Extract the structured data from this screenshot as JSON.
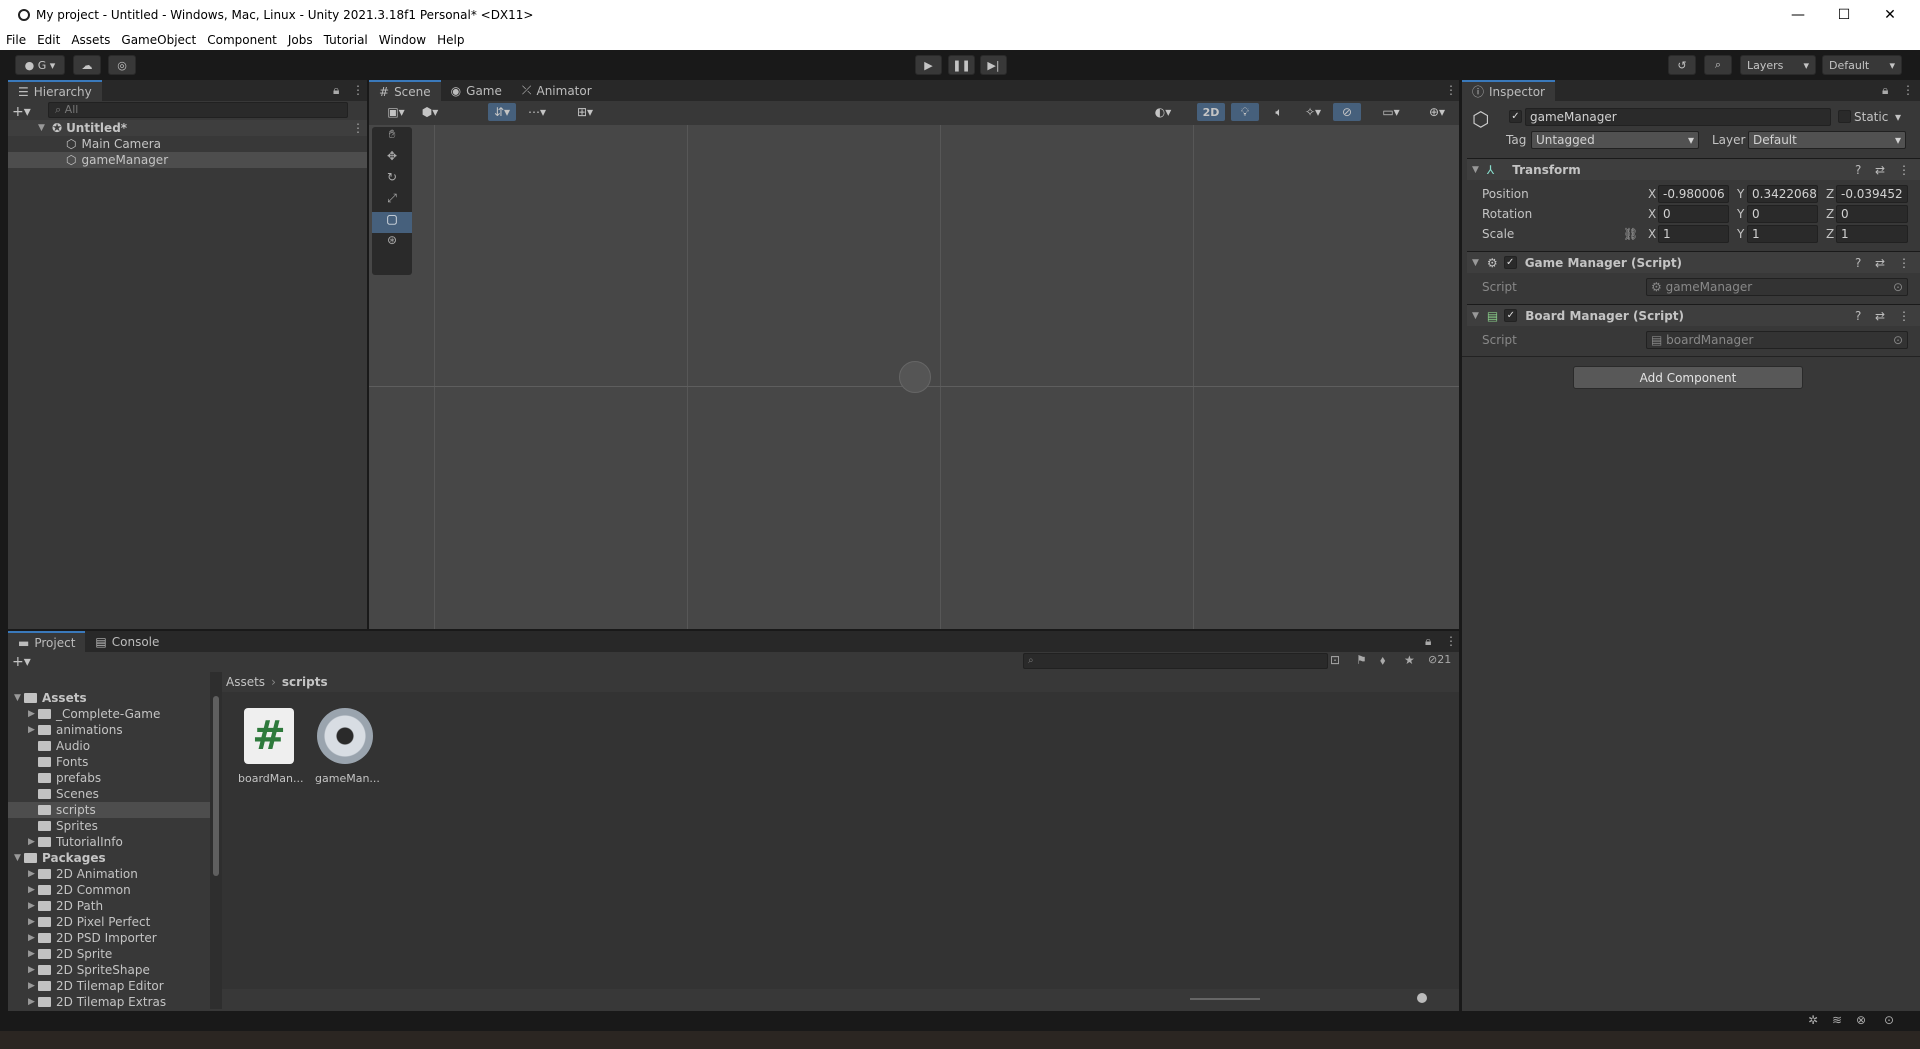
{
  "window": {
    "title": "My project - Untitled - Windows, Mac, Linux - Unity 2021.3.18f1 Personal* <DX11>",
    "minimize": "—",
    "maximize": "☐",
    "close": "✕"
  },
  "menu": [
    "File",
    "Edit",
    "Assets",
    "GameObject",
    "Component",
    "Jobs",
    "Tutorial",
    "Window",
    "Help"
  ],
  "toolbar": {
    "account": "G",
    "layers": "Layers",
    "layout": "Default"
  },
  "hierarchy": {
    "tab": "Hierarchy",
    "search_placeholder": "All",
    "scene": "Untitled*",
    "items": [
      "Main Camera",
      "gameManager"
    ]
  },
  "scene_tabs": [
    "Scene",
    "Game",
    "Animator"
  ],
  "scene_toolbar": {
    "mode2d": "2D"
  },
  "inspector": {
    "tab": "Inspector",
    "object_name": "gameManager",
    "static_label": "Static",
    "tag_label": "Tag",
    "tag_value": "Untagged",
    "layer_label": "Layer",
    "layer_value": "Default",
    "transform": {
      "title": "Transform",
      "position_label": "Position",
      "rotation_label": "Rotation",
      "scale_label": "Scale",
      "position": [
        "-0.980006",
        "0.3422068",
        "-0.039452"
      ],
      "rotation": [
        "0",
        "0",
        "0"
      ],
      "scale": [
        "1",
        "1",
        "1"
      ]
    },
    "game_manager": {
      "title": "Game Manager (Script)",
      "script_label": "Script",
      "script_value": "gameManager"
    },
    "board_manager": {
      "title": "Board Manager (Script)",
      "script_label": "Script",
      "script_value": "boardManager"
    },
    "add_component": "Add Component",
    "axes": [
      "X",
      "Y",
      "Z"
    ]
  },
  "project": {
    "tabs": [
      "Project",
      "Console"
    ],
    "breadcrumb": [
      "Assets",
      "scripts"
    ],
    "hidden_count": "21",
    "tree": [
      {
        "label": "Assets",
        "level": 0,
        "expanded": true,
        "bold": true
      },
      {
        "label": "_Complete-Game",
        "level": 1,
        "arrow": true
      },
      {
        "label": "animations",
        "level": 1,
        "arrow": true
      },
      {
        "label": "Audio",
        "level": 1
      },
      {
        "label": "Fonts",
        "level": 1
      },
      {
        "label": "prefabs",
        "level": 1
      },
      {
        "label": "Scenes",
        "level": 1
      },
      {
        "label": "scripts",
        "level": 1,
        "selected": true
      },
      {
        "label": "Sprites",
        "level": 1
      },
      {
        "label": "TutorialInfo",
        "level": 1,
        "arrow": true
      },
      {
        "label": "Packages",
        "level": 0,
        "expanded": true,
        "bold": true
      },
      {
        "label": "2D Animation",
        "level": 1,
        "arrow": true
      },
      {
        "label": "2D Common",
        "level": 1,
        "arrow": true
      },
      {
        "label": "2D Path",
        "level": 1,
        "arrow": true
      },
      {
        "label": "2D Pixel Perfect",
        "level": 1,
        "arrow": true
      },
      {
        "label": "2D PSD Importer",
        "level": 1,
        "arrow": true
      },
      {
        "label": "2D Sprite",
        "level": 1,
        "arrow": true
      },
      {
        "label": "2D SpriteShape",
        "level": 1,
        "arrow": true
      },
      {
        "label": "2D Tilemap Editor",
        "level": 1,
        "arrow": true
      },
      {
        "label": "2D Tilemap Extras",
        "level": 1,
        "arrow": true
      }
    ],
    "assets": [
      {
        "label": "boardMan...",
        "icon": "csharp-script-icon"
      },
      {
        "label": "gameMan...",
        "icon": "gear-icon"
      }
    ]
  }
}
